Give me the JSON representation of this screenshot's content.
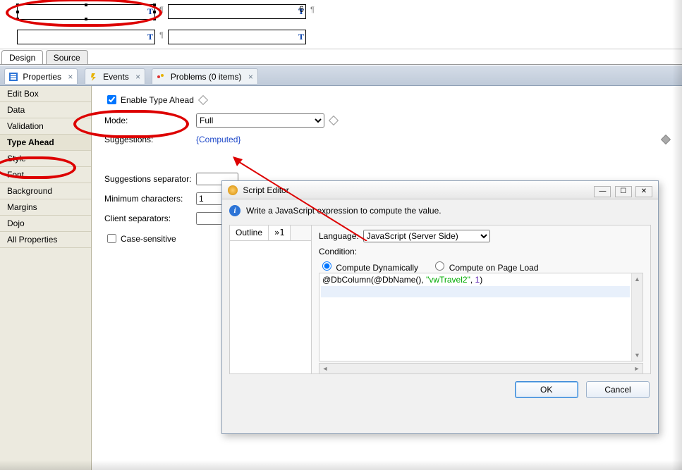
{
  "canvas": {
    "other_label": "6"
  },
  "source_tabs": {
    "design": "Design",
    "source": "Source"
  },
  "panel_tabs": {
    "properties": "Properties",
    "events": "Events",
    "problems": "Problems (0 items)"
  },
  "sidebar": {
    "items": [
      "Edit Box",
      "Data",
      "Validation",
      "Type Ahead",
      "Style",
      "Font",
      "Background",
      "Margins",
      "Dojo",
      "All Properties"
    ]
  },
  "form": {
    "enable_label": "Enable Type Ahead",
    "mode_label": "Mode:",
    "mode_value": "Full",
    "suggestions_label": "Suggestions:",
    "suggestions_value": "{Computed}",
    "separator_label": "Suggestions separator:",
    "separator_value": "",
    "minchars_label": "Minimum characters:",
    "minchars_value": "1",
    "clientsep_label": "Client separators:",
    "clientsep_value": "",
    "casesens_label": "Case-sensitive"
  },
  "dialog": {
    "title": "Script Editor",
    "info": "Write a JavaScript expression to compute the value.",
    "outline_tab": "Outline",
    "outline_tab2": "»1",
    "language_label": "Language:",
    "language_value": "JavaScript (Server Side)",
    "condition_label": "Condition:",
    "radio_dynamic": "Compute Dynamically",
    "radio_onload": "Compute on Page Load",
    "code": {
      "fn1": "@DbColumn",
      "paren_open": "(",
      "fn2": "@DbName",
      "parens2": "(), ",
      "str": "\"vwTravel2\"",
      "comma": ", ",
      "num": "1",
      "paren_close": ")"
    },
    "ok": "OK",
    "cancel": "Cancel"
  }
}
